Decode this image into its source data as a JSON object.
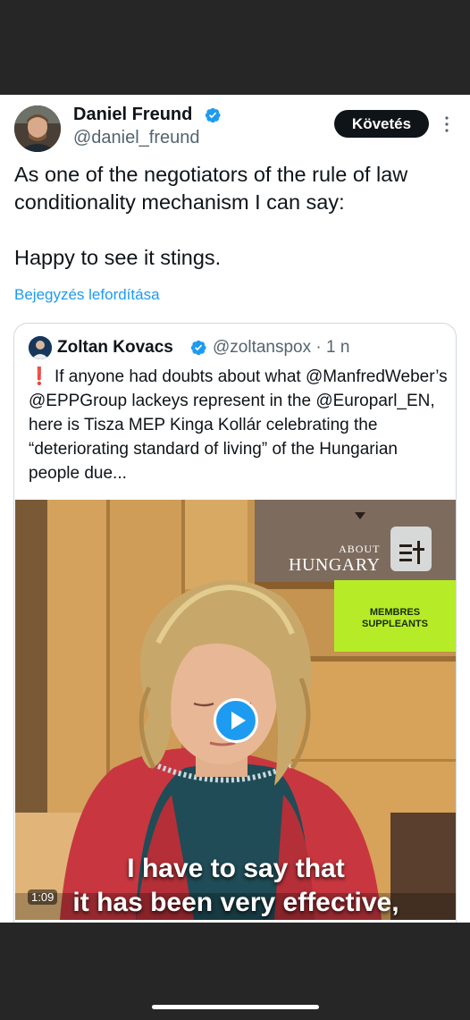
{
  "tweet": {
    "author_name": "Daniel Freund",
    "author_handle": "@daniel_freund",
    "follow_label": "Követés",
    "text_line1": "As one of the negotiators of the rule of law conditionality mechanism I can say:",
    "text_line2": "Happy to see it stings.",
    "translate_label": "Bejegyzés lefordítása"
  },
  "quote": {
    "author_name": "Zoltan Kovacs",
    "author_handle": "@zoltanspox · 1 n",
    "alert_icon": "❗",
    "text": "If anyone had doubts about what @ManfredWeber’s @EPPGroup lackeys represent in the @Europarl_EN, here is Tisza MEP Kinga Kollár celebrating the “deteriorating standard of living” of the Hungarian people due..."
  },
  "video": {
    "watermark_small": "ABOUT",
    "watermark_big": "HUNGARY",
    "sign_line1": "MEMBRES",
    "sign_line2": "SUPPLEANTS",
    "caption_line1": "I have to say that",
    "caption_line2": "it has been very effective,",
    "timestamp": "1:09"
  },
  "icons": {
    "verified": "verified-badge-icon",
    "more": "more-options-icon",
    "play": "play-icon"
  },
  "colors": {
    "accent": "#1d9bf0",
    "follow_bg": "#0f1419",
    "sign_green": "#b6ec27"
  }
}
